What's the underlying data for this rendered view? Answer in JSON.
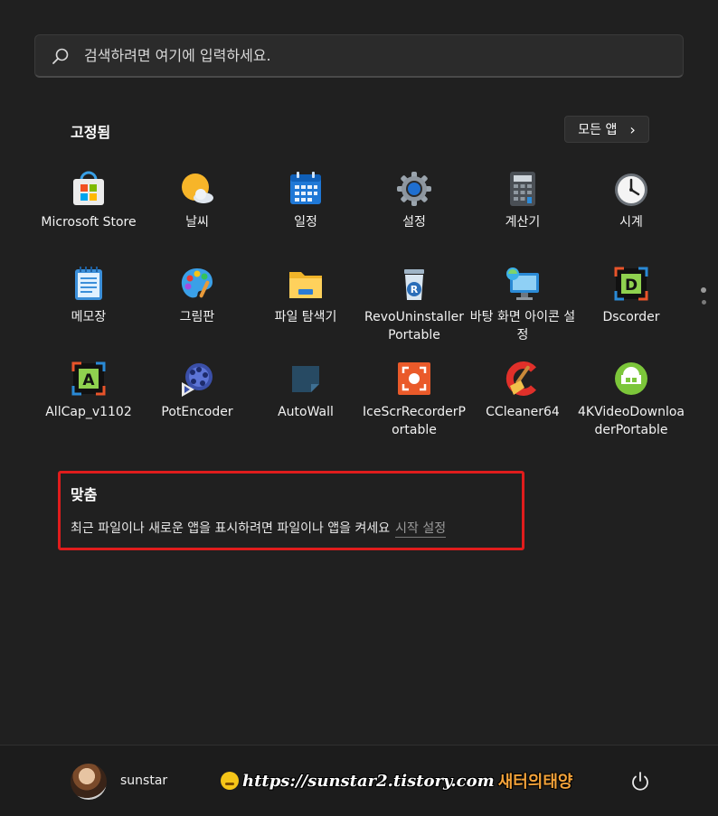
{
  "search": {
    "placeholder": "검색하려면 여기에 입력하세요."
  },
  "pinned": {
    "title": "고정됨",
    "all_apps_label": "모든 앱",
    "all_apps_chevron": "›",
    "apps": [
      {
        "label": "Microsoft Store",
        "icon": "microsoft-store-icon"
      },
      {
        "label": "날씨",
        "icon": "weather-icon"
      },
      {
        "label": "일정",
        "icon": "calendar-icon"
      },
      {
        "label": "설정",
        "icon": "settings-gear-icon"
      },
      {
        "label": "계산기",
        "icon": "calculator-icon"
      },
      {
        "label": "시계",
        "icon": "clock-icon"
      },
      {
        "label": "메모장",
        "icon": "notepad-icon"
      },
      {
        "label": "그림판",
        "icon": "paint-palette-icon"
      },
      {
        "label": "파일 탐색기",
        "icon": "folder-icon"
      },
      {
        "label": "RevoUninstallerPortable",
        "icon": "revo-uninstaller-icon"
      },
      {
        "label": "바탕 화면 아이콘 설정",
        "icon": "desktop-monitor-icon"
      },
      {
        "label": "Dscorder",
        "icon": "dscorder-icon"
      },
      {
        "label": "AllCap_v1102",
        "icon": "allcap-icon"
      },
      {
        "label": "PotEncoder",
        "icon": "film-reel-icon"
      },
      {
        "label": "AutoWall",
        "icon": "autowall-icon"
      },
      {
        "label": "IceScrRecorderPortable",
        "icon": "screen-recorder-icon"
      },
      {
        "label": "CCleaner64",
        "icon": "ccleaner-icon"
      },
      {
        "label": "4KVideoDownloaderPortable",
        "icon": "video-downloader-icon"
      }
    ]
  },
  "recommended": {
    "title": "맞춤",
    "text": "최근 파일이나 새로운 앱을 표시하려면 파일이나 앱을 켜세요",
    "link": "시작 설정"
  },
  "footer": {
    "username": "sunstar",
    "watermark_url": "https://sunstar2.tistory.com",
    "watermark_name": "새터의태양"
  },
  "colors": {
    "background": "#202020",
    "highlight_border": "#e01c1c",
    "accent_blue": "#0a74da"
  }
}
